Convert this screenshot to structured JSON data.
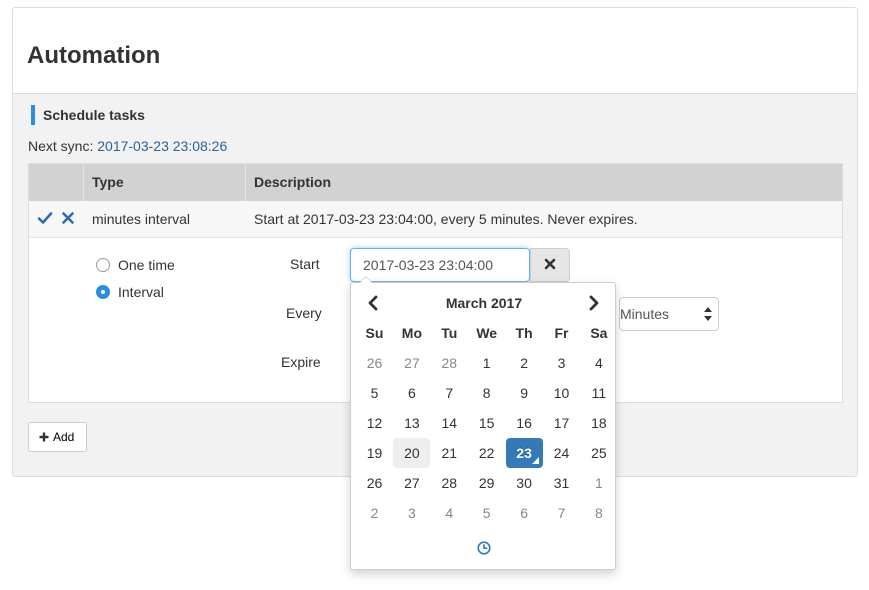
{
  "page": {
    "title": "Automation"
  },
  "schedule": {
    "heading": "Schedule tasks",
    "next_sync_label": "Next sync:",
    "next_sync_value": "2017-03-23 23:08:26"
  },
  "table": {
    "headers": [
      "Type",
      "Description"
    ],
    "rows": [
      {
        "type": "minutes interval",
        "description": "Start at 2017-03-23 23:04:00, every 5 minutes. Never expires."
      }
    ]
  },
  "editor": {
    "radio_options": [
      {
        "label": "One time",
        "checked": false
      },
      {
        "label": "Interval",
        "checked": true
      }
    ],
    "start_label": "Start",
    "start_value": "2017-03-23 23:04:00",
    "every_label": "Every",
    "unit_partial": "Minutes",
    "expire_label": "Expire"
  },
  "add_button": {
    "label": "Add"
  },
  "datepicker": {
    "month_label": "March 2017",
    "weekdays": [
      "Su",
      "Mo",
      "Tu",
      "We",
      "Th",
      "Fr",
      "Sa"
    ],
    "weeks": [
      [
        {
          "d": "26",
          "m": true
        },
        {
          "d": "27",
          "m": true
        },
        {
          "d": "28",
          "m": true
        },
        {
          "d": "1"
        },
        {
          "d": "2"
        },
        {
          "d": "3"
        },
        {
          "d": "4"
        }
      ],
      [
        {
          "d": "5"
        },
        {
          "d": "6"
        },
        {
          "d": "7"
        },
        {
          "d": "8"
        },
        {
          "d": "9"
        },
        {
          "d": "10"
        },
        {
          "d": "11"
        }
      ],
      [
        {
          "d": "12"
        },
        {
          "d": "13"
        },
        {
          "d": "14"
        },
        {
          "d": "15"
        },
        {
          "d": "16"
        },
        {
          "d": "17"
        },
        {
          "d": "18"
        }
      ],
      [
        {
          "d": "19"
        },
        {
          "d": "20",
          "hover": true
        },
        {
          "d": "21"
        },
        {
          "d": "22"
        },
        {
          "d": "23",
          "active": true
        },
        {
          "d": "24"
        },
        {
          "d": "25"
        }
      ],
      [
        {
          "d": "26"
        },
        {
          "d": "27"
        },
        {
          "d": "28"
        },
        {
          "d": "29"
        },
        {
          "d": "30"
        },
        {
          "d": "31"
        },
        {
          "d": "1",
          "m": true
        }
      ],
      [
        {
          "d": "2",
          "m": true
        },
        {
          "d": "3",
          "m": true
        },
        {
          "d": "4",
          "m": true
        },
        {
          "d": "5",
          "m": true
        },
        {
          "d": "6",
          "m": true
        },
        {
          "d": "7",
          "m": true
        },
        {
          "d": "8",
          "m": true
        }
      ]
    ]
  },
  "colors": {
    "accent": "#2a8de0",
    "link": "#2a6496",
    "active_day": "#337ab7",
    "table_header": "#d2d2d2"
  },
  "icons": {
    "confirm": "check-icon",
    "remove": "times-icon",
    "clear": "times-icon",
    "add": "plus-icon",
    "prev": "chevron-left-icon",
    "next": "chevron-right-icon",
    "time": "clock-icon",
    "select": "updown-arrows-icon"
  }
}
